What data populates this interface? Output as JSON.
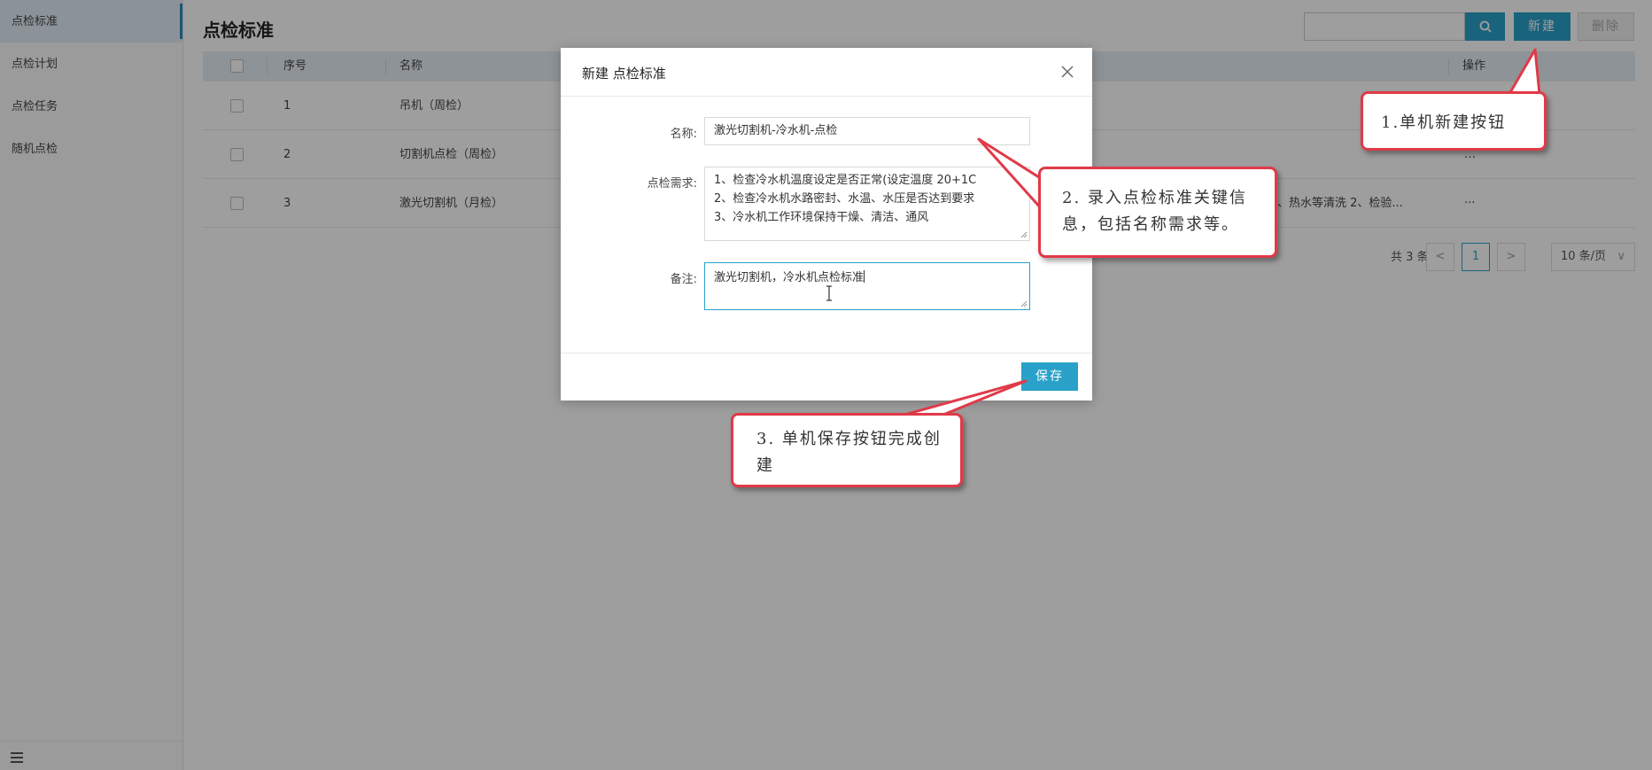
{
  "sidebar": {
    "items": [
      {
        "label": "点检标准",
        "active": true
      },
      {
        "label": "点检计划"
      },
      {
        "label": "点检任务"
      },
      {
        "label": "随机点检"
      }
    ],
    "collapse_icon": "menu-collapse-icon"
  },
  "header": {
    "title": "点检标准",
    "search_placeholder": "",
    "new_label": "新建",
    "delete_label": "删除"
  },
  "table": {
    "columns": [
      "序号",
      "名称",
      "操作"
    ],
    "rows": [
      {
        "index": "1",
        "name": "吊机（周检）",
        "ops": ""
      },
      {
        "index": "2",
        "name": "切割机点检（周检）",
        "ops": "…"
      },
      {
        "index": "3",
        "name": "激光切割机（月检）",
        "extra": "、热水等清洗 2、检验...",
        "ops": "···"
      }
    ]
  },
  "pagination": {
    "total": "共 3 条",
    "prev": "<",
    "current": "1",
    "next": ">",
    "page_size": "10 条/页"
  },
  "modal": {
    "title": "新建 点检标准",
    "name_label": "名称:",
    "name_value": "激光切割机-冷水机-点检",
    "req_label": "点检需求:",
    "req_lines": [
      "1、检查冷水机温度设定是否正常(设定温度 20+1C",
      "2、检查冷水机水路密封、水温、水压是否达到要求",
      "3、冷水机工作环境保持干燥、清洁、通风"
    ],
    "note_label": "备注:",
    "note_value": "激光切割机，冷水机点检标准",
    "save_label": "保存"
  },
  "callouts": {
    "one": "1.单机新建按钮",
    "two": "2. 录入点检标准关键信息，包括名称需求等。",
    "three": "3. 单机保存按钮完成创建"
  },
  "colors": {
    "accent": "#2aa1c9",
    "callout_border": "#e03a48"
  }
}
